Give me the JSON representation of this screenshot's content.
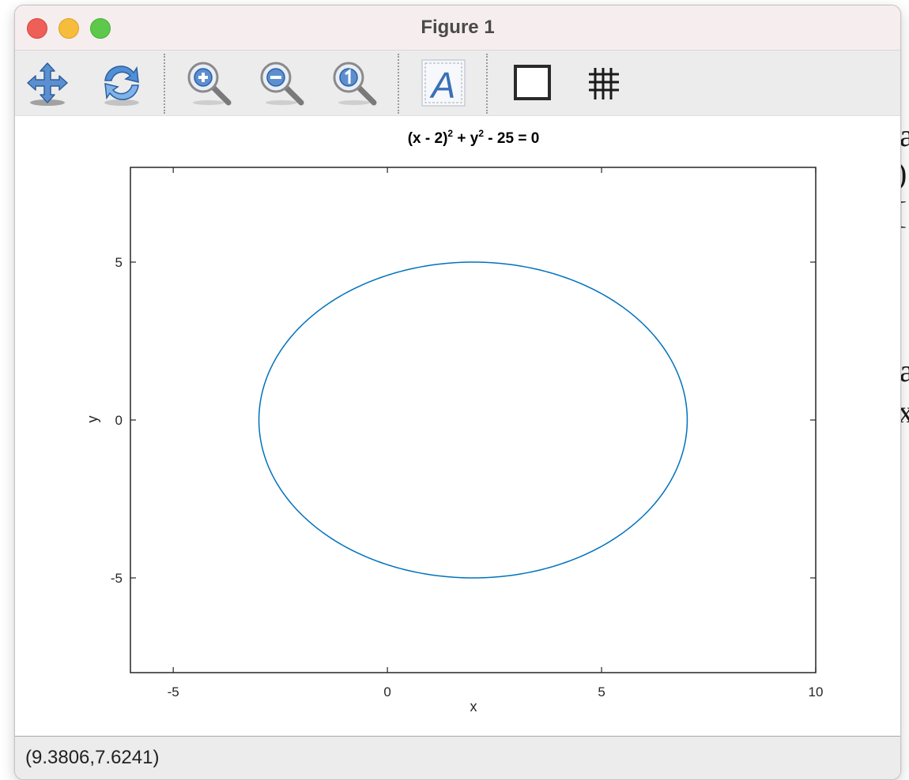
{
  "window": {
    "title": "Figure 1"
  },
  "toolbar": {
    "tools": [
      "pan-icon",
      "rotate-icon",
      "zoom-in-icon",
      "zoom-out-icon",
      "zoom-reset-icon",
      "insert-text-icon",
      "toggle-box-icon",
      "toggle-grid-icon"
    ]
  },
  "status": {
    "coordinates": "(9.3806,7.6241)"
  },
  "colors": {
    "series": "#0072bd",
    "axis": "#262626",
    "titlebar": "#f6eeee",
    "toolbar": "#ececec"
  },
  "chart_data": {
    "type": "line",
    "title": {
      "base": "(x - 2)",
      "exp1": "2",
      "mid": " + y",
      "exp2": "2",
      "tail": " - 25 = 0"
    },
    "xlabel": "x",
    "ylabel": "y",
    "xlim": [
      -6,
      10
    ],
    "ylim": [
      -8,
      8
    ],
    "xticks": [
      -5,
      0,
      5,
      10
    ],
    "yticks": [
      -5,
      0,
      5
    ],
    "xtick_labels": [
      "-5",
      "0",
      "5",
      "10"
    ],
    "ytick_labels": [
      "-5",
      "0",
      "5"
    ],
    "grid": false,
    "series": [
      {
        "equation": "(x - 2)^2 + y^2 - 25 = 0",
        "center": [
          2,
          0
        ],
        "radius": 5
      }
    ]
  }
}
